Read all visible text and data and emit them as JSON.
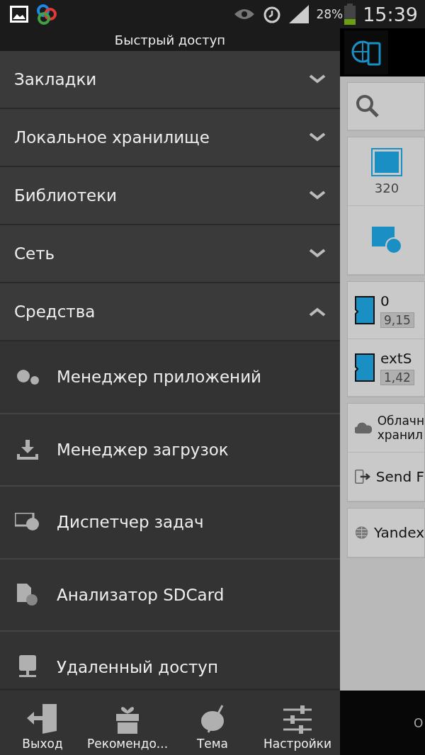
{
  "status_bar": {
    "battery": "28%",
    "time": "15:39"
  },
  "drawer": {
    "title": "Быстрый доступ",
    "sections": [
      {
        "label": "Закладки",
        "expanded": false
      },
      {
        "label": "Локальное хранилище",
        "expanded": false
      },
      {
        "label": "Библиотеки",
        "expanded": false
      },
      {
        "label": "Сеть",
        "expanded": false
      },
      {
        "label": "Средства",
        "expanded": true,
        "children": [
          {
            "label": "Менеджер приложений"
          },
          {
            "label": "Менеджер загрузок"
          },
          {
            "label": "Диспетчер задач"
          },
          {
            "label": "Анализатор SDCard"
          },
          {
            "label": "Удаленный доступ"
          }
        ]
      }
    ],
    "bottom_bar": [
      "Выход",
      "Рекомендо...",
      "Тема",
      "Настройки"
    ]
  },
  "background": {
    "image_count": "320",
    "storages": [
      {
        "name": "0",
        "size": "9,15"
      },
      {
        "name": "extS",
        "size": "1,42"
      }
    ],
    "services": [
      {
        "label": "Облачн\nхранил"
      },
      {
        "label": "Send F"
      }
    ],
    "network": [
      {
        "label": "Yandex"
      }
    ],
    "bottom_text": "О"
  }
}
